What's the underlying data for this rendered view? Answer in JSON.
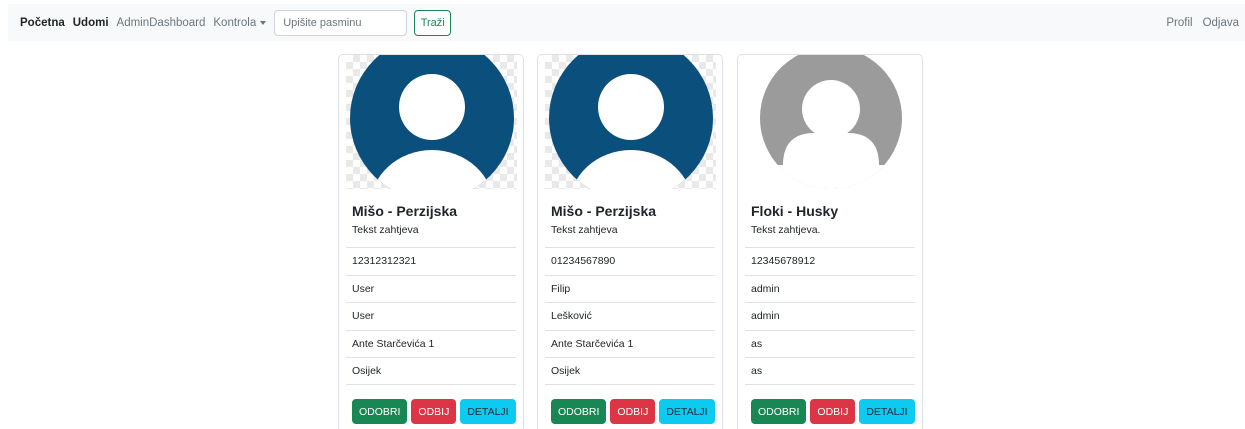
{
  "navbar": {
    "home": "Početna",
    "adopt": "Udomi",
    "admin_dashboard": "AdminDashboard",
    "control": "Kontrola",
    "search_placeholder": "Upišite pasminu",
    "search_button": "Traži",
    "profile": "Profil",
    "logout": "Odjava"
  },
  "colors": {
    "success": "#198754",
    "danger": "#dc3545",
    "info": "#0dcaf0",
    "avatar_blue": "#0b4f7c",
    "avatar_gray": "#9b9b9b"
  },
  "cards": [
    {
      "avatar": "blue-avatar-icon",
      "title": "Mišo - Perzijska",
      "text": "Tekst zahtjeva",
      "items": [
        "12312312321",
        "User",
        "User",
        "Ante Starčevića 1",
        "Osijek"
      ],
      "approve": "ODOBRI",
      "reject": "ODBIJ",
      "details": "DETALJI"
    },
    {
      "avatar": "blue-avatar-icon",
      "title": "Mišo - Perzijska",
      "text": "Tekst zahtjeva",
      "items": [
        "01234567890",
        "Filip",
        "Lešković",
        "Ante Starčevića 1",
        "Osijek"
      ],
      "approve": "ODOBRI",
      "reject": "ODBIJ",
      "details": "DETALJI"
    },
    {
      "avatar": "gray-avatar-icon",
      "title": "Floki - Husky",
      "text": "Tekst zahtjeva.",
      "items": [
        "12345678912",
        "admin",
        "admin",
        "as",
        "as"
      ],
      "approve": "ODOBRI",
      "reject": "ODBIJ",
      "details": "DETALJI"
    }
  ]
}
